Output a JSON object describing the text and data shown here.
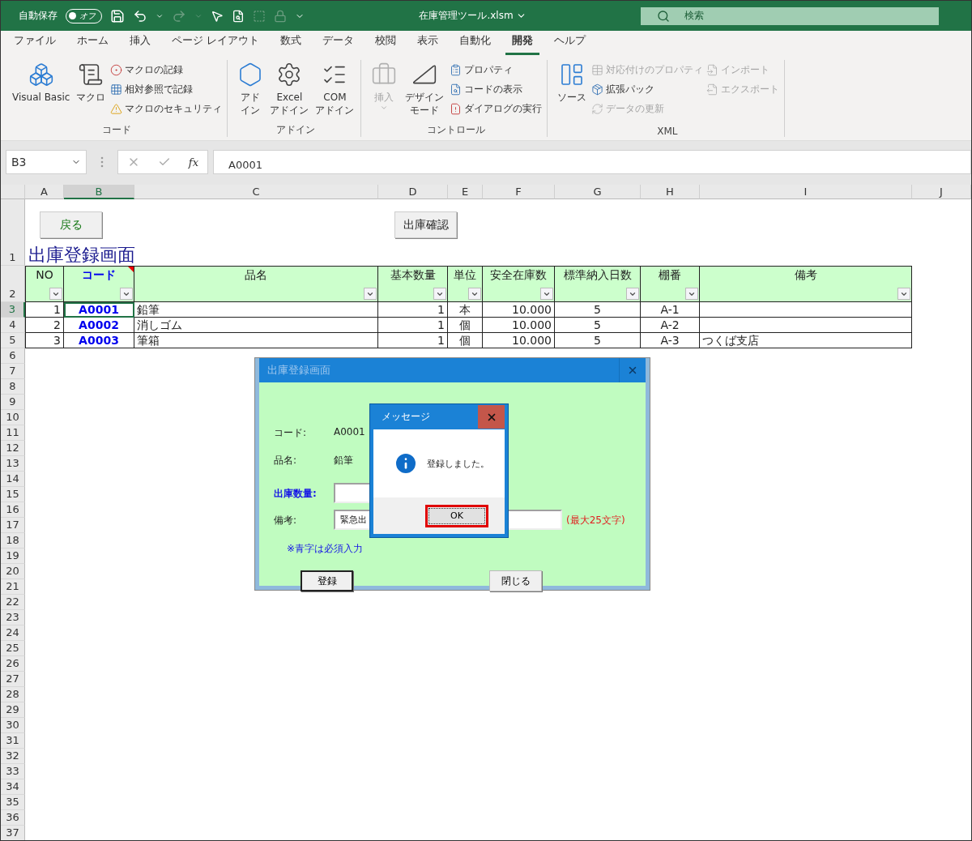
{
  "titlebar": {
    "autosave_label": "自動保存",
    "autosave_toggle": {
      "label": "オフ",
      "on": false
    },
    "filename": "在庫管理ツール.xlsm",
    "search": {
      "placeholder": "検索"
    }
  },
  "menu_tabs": [
    {
      "label": "ファイル",
      "selected": false
    },
    {
      "label": "ホーム",
      "selected": false
    },
    {
      "label": "挿入",
      "selected": false
    },
    {
      "label": "ページ レイアウト",
      "selected": false
    },
    {
      "label": "数式",
      "selected": false
    },
    {
      "label": "データ",
      "selected": false
    },
    {
      "label": "校閲",
      "selected": false
    },
    {
      "label": "表示",
      "selected": false
    },
    {
      "label": "自動化",
      "selected": false
    },
    {
      "label": "開発",
      "selected": true
    },
    {
      "label": "ヘルプ",
      "selected": false
    }
  ],
  "ribbon_groups": [
    {
      "label": "コード",
      "items": [
        {
          "kind": "large",
          "label": "Visual Basic",
          "disabled": false
        },
        {
          "kind": "large",
          "label": "マクロ",
          "disabled": false
        },
        {
          "kind": "stack",
          "items": [
            {
              "label": "マクロの記録",
              "disabled": false
            },
            {
              "label": "相対参照で記録",
              "disabled": false
            },
            {
              "label": "マクロのセキュリティ",
              "disabled": false
            }
          ]
        }
      ]
    },
    {
      "label": "アドイン",
      "items": [
        {
          "kind": "large",
          "label": "アドイン",
          "disabled": false
        },
        {
          "kind": "large",
          "label": "Excel\nアドイン",
          "disabled": false
        },
        {
          "kind": "large",
          "label": "COM\nアドイン",
          "disabled": false
        }
      ]
    },
    {
      "label": "コントロール",
      "items": [
        {
          "kind": "large",
          "label": "挿入",
          "disabled": true,
          "dropdown": true
        },
        {
          "kind": "large",
          "label": "デザインモード",
          "disabled": false
        },
        {
          "kind": "stack",
          "items": [
            {
              "label": "プロパティ",
              "disabled": false
            },
            {
              "label": "コードの表示",
              "disabled": false
            },
            {
              "label": "ダイアログの実行",
              "disabled": false
            }
          ]
        }
      ]
    },
    {
      "label": "XML",
      "items": [
        {
          "kind": "large",
          "label": "ソース",
          "disabled": false
        },
        {
          "kind": "stack",
          "items": [
            {
              "label": "対応付けのプロパティ",
              "disabled": true
            },
            {
              "label": "拡張パック",
              "disabled": false
            },
            {
              "label": "データの更新",
              "disabled": true
            }
          ]
        },
        {
          "kind": "stack",
          "items": [
            {
              "label": "インポート",
              "disabled": true
            },
            {
              "label": "エクスポート",
              "disabled": true
            }
          ]
        }
      ]
    }
  ],
  "name_box": "B3",
  "function_symbol": "fx",
  "formula": "A0001",
  "columns": [
    {
      "label": "A",
      "selected": false
    },
    {
      "label": "B",
      "selected": true
    },
    {
      "label": "C",
      "selected": false
    },
    {
      "label": "D",
      "selected": false
    },
    {
      "label": "E",
      "selected": false
    },
    {
      "label": "F",
      "selected": false
    },
    {
      "label": "G",
      "selected": false
    },
    {
      "label": "H",
      "selected": false
    },
    {
      "label": "I",
      "selected": false
    },
    {
      "label": "J",
      "selected": false
    }
  ],
  "row_numbers": [
    {
      "label": "1",
      "selected": false
    },
    {
      "label": "2",
      "selected": false
    },
    {
      "label": "3",
      "selected": true
    },
    {
      "label": "4",
      "selected": false
    },
    {
      "label": "5",
      "selected": false
    },
    {
      "label": "6",
      "selected": false
    },
    {
      "label": "7",
      "selected": false
    },
    {
      "label": "8",
      "selected": false
    },
    {
      "label": "9",
      "selected": false
    },
    {
      "label": "10",
      "selected": false
    },
    {
      "label": "11",
      "selected": false
    },
    {
      "label": "12",
      "selected": false
    },
    {
      "label": "13",
      "selected": false
    },
    {
      "label": "14",
      "selected": false
    },
    {
      "label": "15",
      "selected": false
    },
    {
      "label": "16",
      "selected": false
    },
    {
      "label": "17",
      "selected": false
    },
    {
      "label": "18",
      "selected": false
    },
    {
      "label": "19",
      "selected": false
    },
    {
      "label": "20",
      "selected": false
    },
    {
      "label": "21",
      "selected": false
    },
    {
      "label": "22",
      "selected": false
    },
    {
      "label": "23",
      "selected": false
    },
    {
      "label": "24",
      "selected": false
    },
    {
      "label": "25",
      "selected": false
    },
    {
      "label": "26",
      "selected": false
    },
    {
      "label": "27",
      "selected": false
    },
    {
      "label": "28",
      "selected": false
    },
    {
      "label": "29",
      "selected": false
    },
    {
      "label": "30",
      "selected": false
    },
    {
      "label": "31",
      "selected": false
    },
    {
      "label": "32",
      "selected": false
    },
    {
      "label": "33",
      "selected": false
    },
    {
      "label": "34",
      "selected": false
    },
    {
      "label": "35",
      "selected": false
    },
    {
      "label": "36",
      "selected": false
    },
    {
      "label": "37",
      "selected": false
    }
  ],
  "sheet_buttons": [
    {
      "label": "戻る"
    },
    {
      "label": "出庫確認"
    }
  ],
  "sheet_title": "出庫登録画面",
  "table": {
    "headers": [
      {
        "label": "NO",
        "required": false,
        "has_comment": false
      },
      {
        "label": "コード",
        "required": true,
        "has_comment": true
      },
      {
        "label": "品名",
        "required": false,
        "has_comment": false
      },
      {
        "label": "基本数量",
        "required": false,
        "has_comment": false
      },
      {
        "label": "単位",
        "required": false,
        "has_comment": false
      },
      {
        "label": "安全在庫数",
        "required": false,
        "has_comment": false
      },
      {
        "label": "標準納入日数",
        "required": false,
        "has_comment": false
      },
      {
        "label": "棚番",
        "required": false,
        "has_comment": false
      },
      {
        "label": "備考",
        "required": false,
        "has_comment": false
      }
    ],
    "rows": [
      [
        "1",
        "A0001",
        "鉛筆",
        "1",
        "本",
        "10.000",
        "5",
        "A-1",
        ""
      ],
      [
        "2",
        "A0002",
        "消しゴム",
        "1",
        "個",
        "10.000",
        "5",
        "A-2",
        ""
      ],
      [
        "3",
        "A0003",
        "筆箱",
        "1",
        "個",
        "10.000",
        "5",
        "A-3",
        "つくば支店"
      ]
    ]
  },
  "userform": {
    "title": "出庫登録画面",
    "fields": [
      {
        "kind": "text",
        "label": "コード:",
        "value": "A0001",
        "required": false
      },
      {
        "kind": "text",
        "label": "品名:",
        "value": "鉛筆",
        "required": false
      },
      {
        "kind": "input",
        "label": "出庫数量:",
        "required": true
      },
      {
        "kind": "input",
        "label": "備考:",
        "value": "緊急出",
        "required": false,
        "hint": "(最大25文字)"
      }
    ],
    "note": "※青字は必須入力",
    "buttons": [
      {
        "label": "登録",
        "default": true
      },
      {
        "label": "閉じる",
        "default": false
      }
    ]
  },
  "message_box": {
    "title": "メッセージ",
    "message": "登録しました。",
    "button": "OK"
  }
}
